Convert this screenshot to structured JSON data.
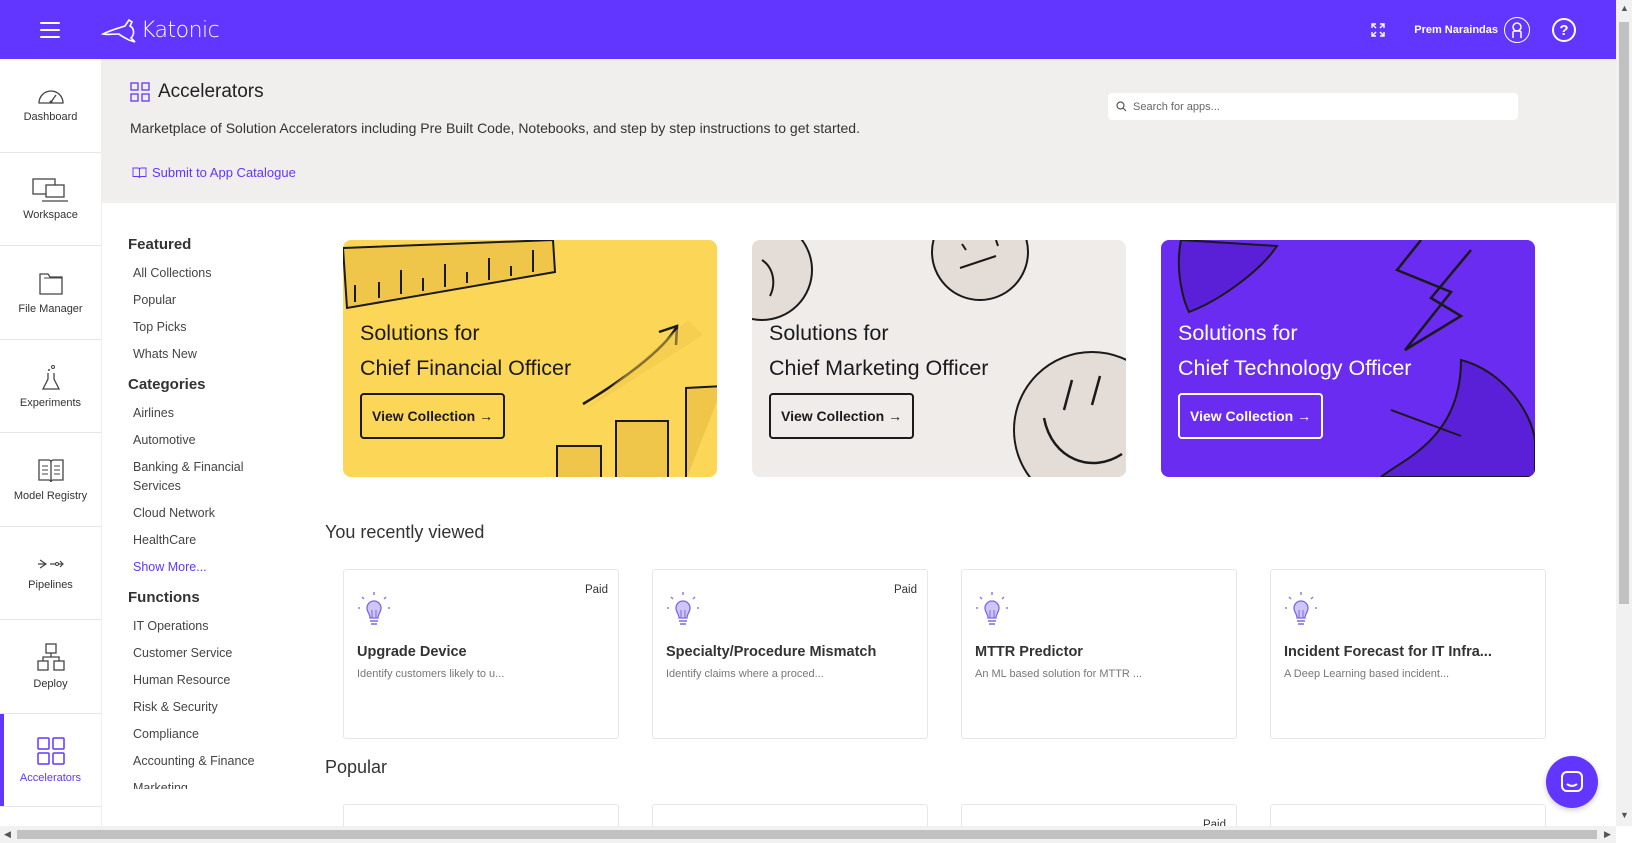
{
  "app": {
    "logo_text": "Katonic"
  },
  "topbar": {
    "user_name": "Prem Naraindas",
    "help_label": "?"
  },
  "sidebar": {
    "items": [
      {
        "label": "Dashboard",
        "icon": "gauge-icon"
      },
      {
        "label": "Workspace",
        "icon": "laptop-icon"
      },
      {
        "label": "File Manager",
        "icon": "folder-icon"
      },
      {
        "label": "Experiments",
        "icon": "flask-icon"
      },
      {
        "label": "Model Registry",
        "icon": "book-icon"
      },
      {
        "label": "Pipelines",
        "icon": "pipeline-icon"
      },
      {
        "label": "Deploy",
        "icon": "deploy-icon"
      },
      {
        "label": "Accelerators",
        "icon": "grid-icon",
        "active": true
      }
    ]
  },
  "header": {
    "title": "Accelerators",
    "subtitle": "Marketplace of Solution Accelerators including Pre Built Code, Notebooks, and step by step instructions to get started.",
    "submit_link": "Submit to App Catalogue",
    "search_placeholder": "Search for apps..."
  },
  "filters": {
    "featured": {
      "heading": "Featured",
      "items": [
        "All Collections",
        "Popular",
        "Top Picks",
        "Whats New"
      ]
    },
    "categories": {
      "heading": "Categories",
      "items": [
        "Airlines",
        "Automotive",
        "Banking & Financial Services",
        "Cloud Network",
        "HealthCare"
      ],
      "show_more": "Show More..."
    },
    "functions": {
      "heading": "Functions",
      "items": [
        "IT Operations",
        "Customer Service",
        "Human Resource",
        "Risk & Security",
        "Compliance",
        "Accounting & Finance",
        "Marketing"
      ]
    }
  },
  "banners": [
    {
      "line1": "Solutions for",
      "line2": "Chief Financial Officer",
      "button": "View Collection →",
      "bg": "#fcd757",
      "fg": "#1a1a1a"
    },
    {
      "line1": "Solutions for",
      "line2": "Chief Marketing Officer",
      "button": "View Collection →",
      "bg": "#f0ecea",
      "fg": "#1a1a1a"
    },
    {
      "line1": "Solutions for",
      "line2": "Chief Technology Officer",
      "button": "View Collection →",
      "bg": "#6a2cf0",
      "fg": "#ffffff"
    }
  ],
  "recently_viewed": {
    "heading": "You recently viewed",
    "cards": [
      {
        "title": "Upgrade Device",
        "desc": "Identify customers likely to u...",
        "badge": "Paid"
      },
      {
        "title": "Specialty/Procedure Mismatch",
        "desc": "Identify claims where a proced...",
        "badge": "Paid"
      },
      {
        "title": "MTTR Predictor",
        "desc": "An ML based solution for MTTR ...",
        "badge": ""
      },
      {
        "title": "Incident Forecast for IT Infra...",
        "desc": "A Deep Learning based incident...",
        "badge": ""
      }
    ]
  },
  "popular": {
    "heading": "Popular",
    "badges": [
      "",
      "",
      "Paid",
      ""
    ]
  },
  "colors": {
    "accent": "#6236ff",
    "header_bg": "#f1eeee"
  }
}
